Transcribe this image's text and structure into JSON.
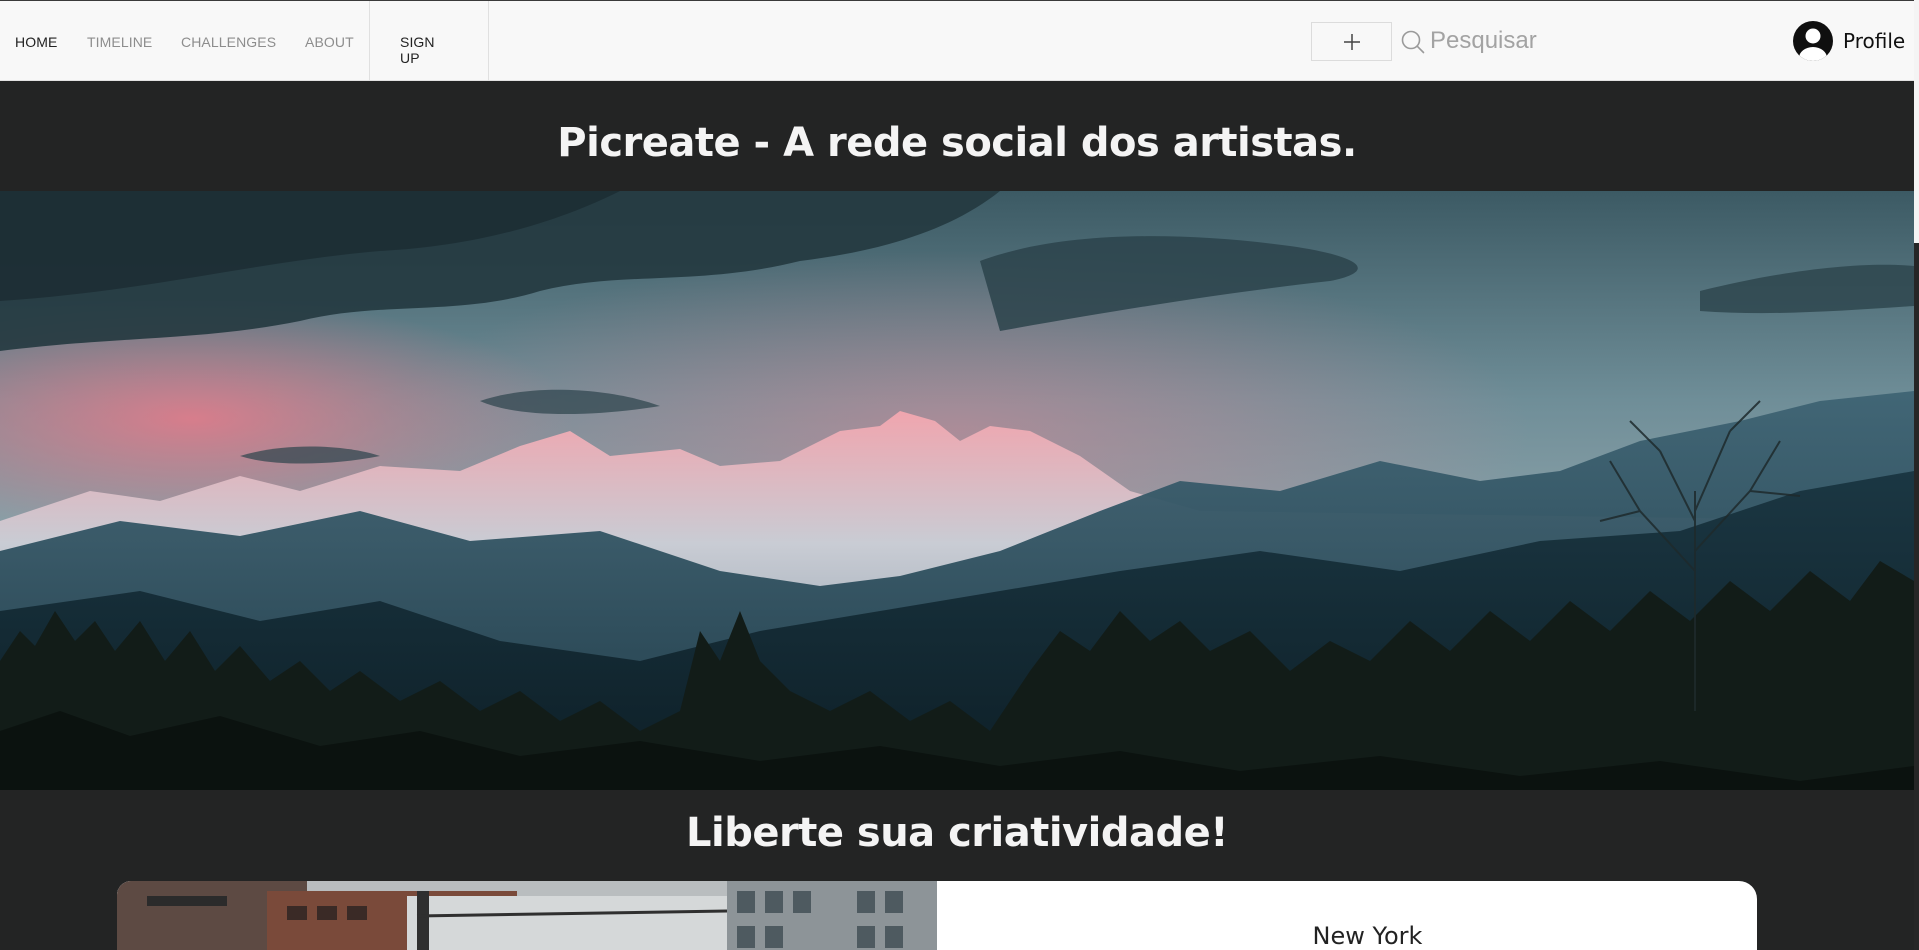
{
  "nav": {
    "home": "HOME",
    "timeline": "TIMELINE",
    "challenges": "CHALLENGES",
    "about": "ABOUT",
    "signup": "SIGN UP"
  },
  "toolbar": {
    "add_icon": "plus-icon",
    "search_icon": "search-icon",
    "search_placeholder": "Pesquisar"
  },
  "profile": {
    "label": "Profile",
    "avatar_icon": "user-avatar-icon"
  },
  "header": {
    "title": "Picreate - A rede social dos artistas."
  },
  "hero": {
    "image": "mountain-sunset-photo"
  },
  "section": {
    "title": "Liberte sua criatividade!"
  },
  "featured_card": {
    "image": "new-york-street-photo",
    "city": "New York"
  },
  "colors": {
    "topbar_bg": "#f8f8f8",
    "page_bg": "#232424",
    "text_light": "#f4f4f4",
    "nav_active": "#222222",
    "nav_inactive": "#8d8d8d"
  }
}
